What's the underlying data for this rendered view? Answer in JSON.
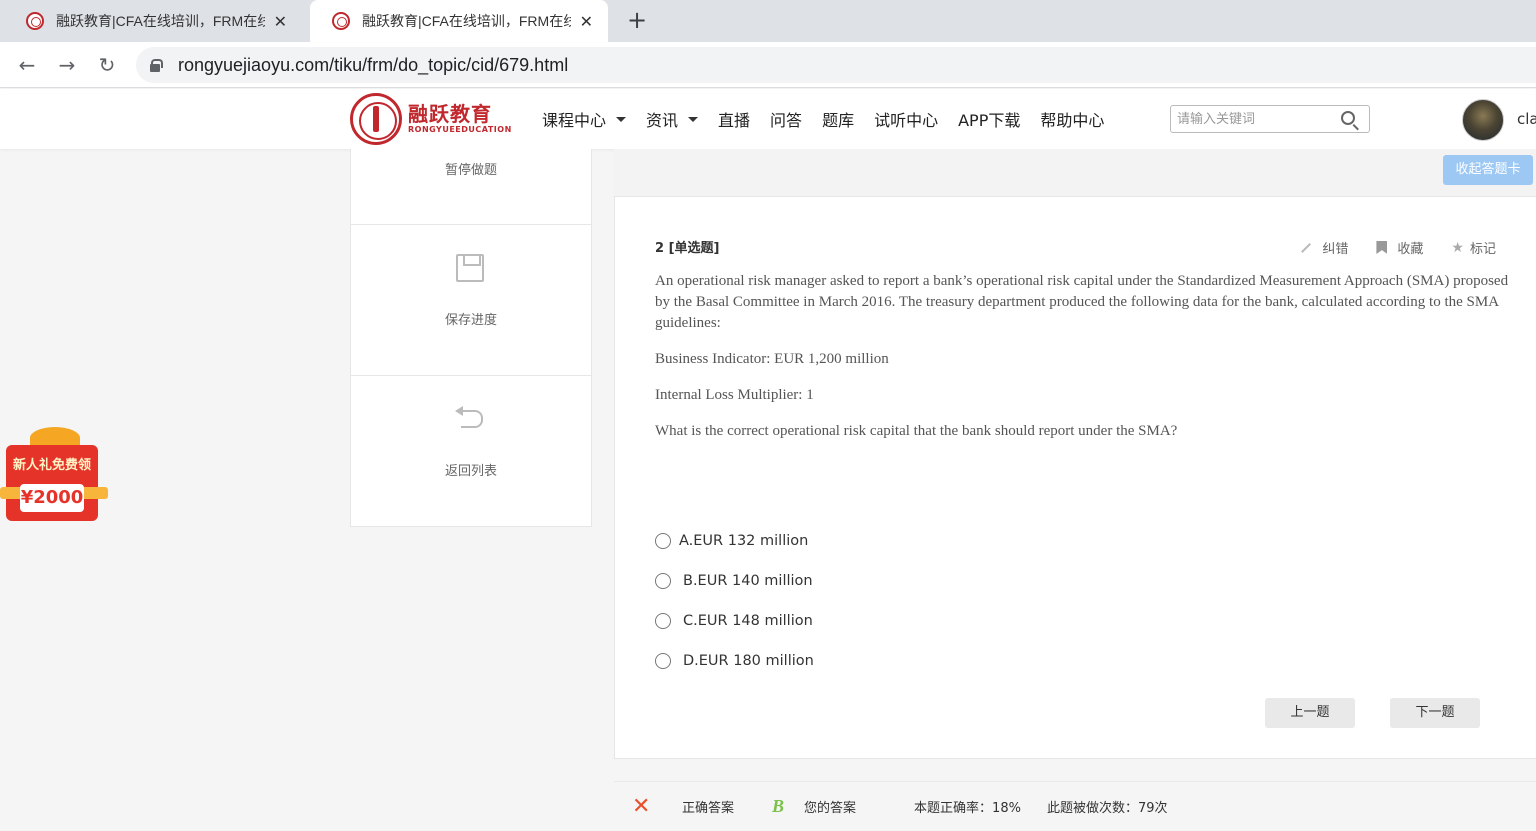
{
  "browser": {
    "tabs": [
      {
        "title": "融跃教育|CFA在线培训，FRM在线",
        "close": "✕"
      },
      {
        "title": "融跃教育|CFA在线培训，FRM在线",
        "close": "✕"
      }
    ],
    "new_tab": "+",
    "back": "←",
    "forward": "→",
    "reload": "↻",
    "url": "rongyuejiaoyu.com/tiku/frm/do_topic/cid/679.html"
  },
  "header": {
    "logo_cn": "融跃教育",
    "logo_en": "RONGYUEEDUCATION",
    "nav": [
      "课程中心",
      "资讯",
      "直播",
      "问答",
      "题库",
      "试听中心",
      "APP下载",
      "帮助中心"
    ],
    "search_placeholder": "请输入关键词",
    "username": "cla"
  },
  "side": {
    "pause": "暂停做题",
    "save": "保存进度",
    "back_to_list": "返回列表"
  },
  "promo": {
    "title": "新人礼免费领",
    "amount": "¥2000"
  },
  "collapse_button": "收起答题卡",
  "question": {
    "number": "2",
    "type": "[单选题]",
    "actions": {
      "report": "纠错",
      "favorite": "收藏",
      "mark": "标记"
    },
    "paragraphs": [
      "An operational risk manager asked to report a bank’s operational risk capital under the Standardized Measurement Approach (SMA) proposed by the Basal Committee in March 2016. The treasury department produced the following data for the bank, calculated according to the SMA guidelines:",
      "Business Indicator: EUR 1,200 million",
      "Internal Loss Multiplier: 1",
      "What is the correct operational risk capital that the bank should report under the SMA?"
    ],
    "options": [
      "A.EUR 132 million",
      "B.EUR 140 million",
      "C.EUR 148 million",
      "D.EUR 180 million"
    ],
    "prev": "上一题",
    "next": "下一题"
  },
  "answer_bar": {
    "wrong_mark": "✕",
    "correct_label": "正确答案",
    "your_answer": "B",
    "your_label": "您的答案",
    "accuracy": "本题正确率：18%",
    "attempts": "此题被做次数：79次"
  },
  "colors": {
    "brand_red": "#c0282d",
    "collapse_button_bg": "#9cc8f3",
    "wrong_mark": "#e8502b",
    "your_answer": "#7cc24a"
  }
}
